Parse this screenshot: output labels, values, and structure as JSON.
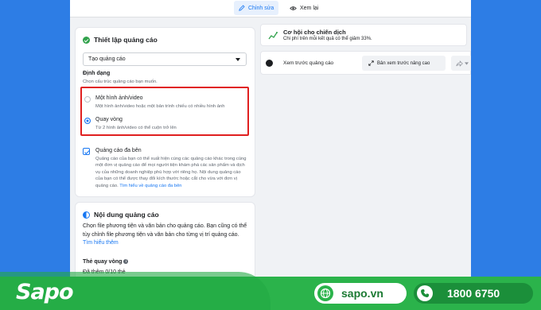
{
  "tabs": {
    "edit_label": "Chỉnh sửa",
    "review_label": "Xem lại"
  },
  "ad_setup": {
    "title": "Thiết lập quảng cáo",
    "create_select_value": "Tạo quảng cáo",
    "format_label": "Định dạng",
    "format_help": "Chọn cấu trúc quảng cáo bạn muốn.",
    "options": [
      {
        "title": "Một hình ảnh/video",
        "description": "Một hình ảnh/video hoặc một bản trình chiếu có nhiều hình ảnh",
        "selected": false
      },
      {
        "title": "Quay vòng",
        "description": "Từ 2 hình ảnh/video có thể cuộn trở lên",
        "selected": true
      }
    ],
    "multi_advertiser_label": "Quảng cáo đa bên",
    "multi_advertiser_desc": "Quảng cáo của bạn có thể xuất hiện cùng các quảng cáo khác trong cùng một đơn vị quảng cáo để mọi người tiện khám phá các sản phẩm và dịch vụ của những doanh nghiệp phù hợp với riêng họ. Nội dung quảng cáo của bạn có thể được thay đổi kích thước hoặc cắt cho vừa với đơn vị quảng cáo.",
    "multi_advertiser_link": "Tìm hiểu về quảng cáo đa bên",
    "multi_advertiser_checked": true
  },
  "ad_content": {
    "title": "Nội dung quảng cáo",
    "description": "Chọn file phương tiện và văn bản cho quảng cáo. Bạn cũng có thể tùy chỉnh file phương tiện và văn bản cho từng vị trí quảng cáo.",
    "learn_more": "Tìm hiểu thêm",
    "carousel_cards_label": "Thẻ quay vòng",
    "added_count": "Đã thêm 0/10 thẻ"
  },
  "opportunity": {
    "title": "Cơ hội cho chiến dịch",
    "subtitle": "Chi phí trên mỗi kết quả có thể giảm 33%."
  },
  "preview": {
    "label": "Xem trước quảng cáo",
    "advanced_label": "Bản xem trước nâng cao"
  },
  "banner": {
    "logo": "Sapo",
    "website": "sapo.vn",
    "phone": "1800 6750"
  },
  "colors": {
    "accent": "#1877f2",
    "highlight_border": "#e02020",
    "banner_green": "#2bb34b"
  }
}
